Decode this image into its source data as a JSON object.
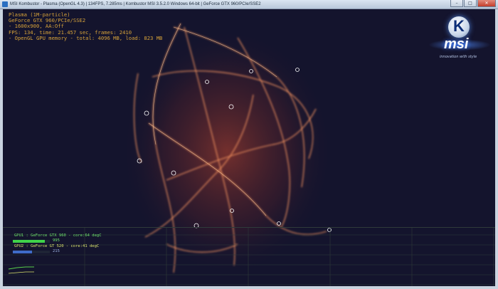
{
  "window": {
    "title": "MSI Kombustor - Plasma (OpenGL 4.3) | 134FPS, 7.285ms | Kombustor MSI 3.5.2.0 Windows 64-bit | GeForce GTX 960/PCIe/SSE2",
    "title_ghost": "",
    "controls": {
      "minimize": "–",
      "maximize": "□",
      "close": "✕"
    }
  },
  "overlay": {
    "lines": [
      "Plasma (1M-particle)",
      "GeForce GTX 960/PCIe/SSE2",
      "- 1600x900, AA:Off",
      "FPS: 134, time: 21.457 sec, frames: 2410",
      "- OpenGL GPU memory - total: 4096 MB, load: 823 MB"
    ]
  },
  "logo": {
    "letter": "K",
    "brand": "msi",
    "slogan": "innovation with style"
  },
  "hud": {
    "gpu1": {
      "label": "GPU1 : GeForce GTX 960 - core:64 degC",
      "value": "995",
      "level": 0.86,
      "color": "#3fd24a"
    },
    "gpu2": {
      "label": "GPU2 : GeForce GT 520 - core:41 degC",
      "value": "215",
      "level": 0.52,
      "color": "#3f6bc8"
    },
    "grid_color": "#2e3a3a",
    "graph_color": "#59d04b"
  }
}
